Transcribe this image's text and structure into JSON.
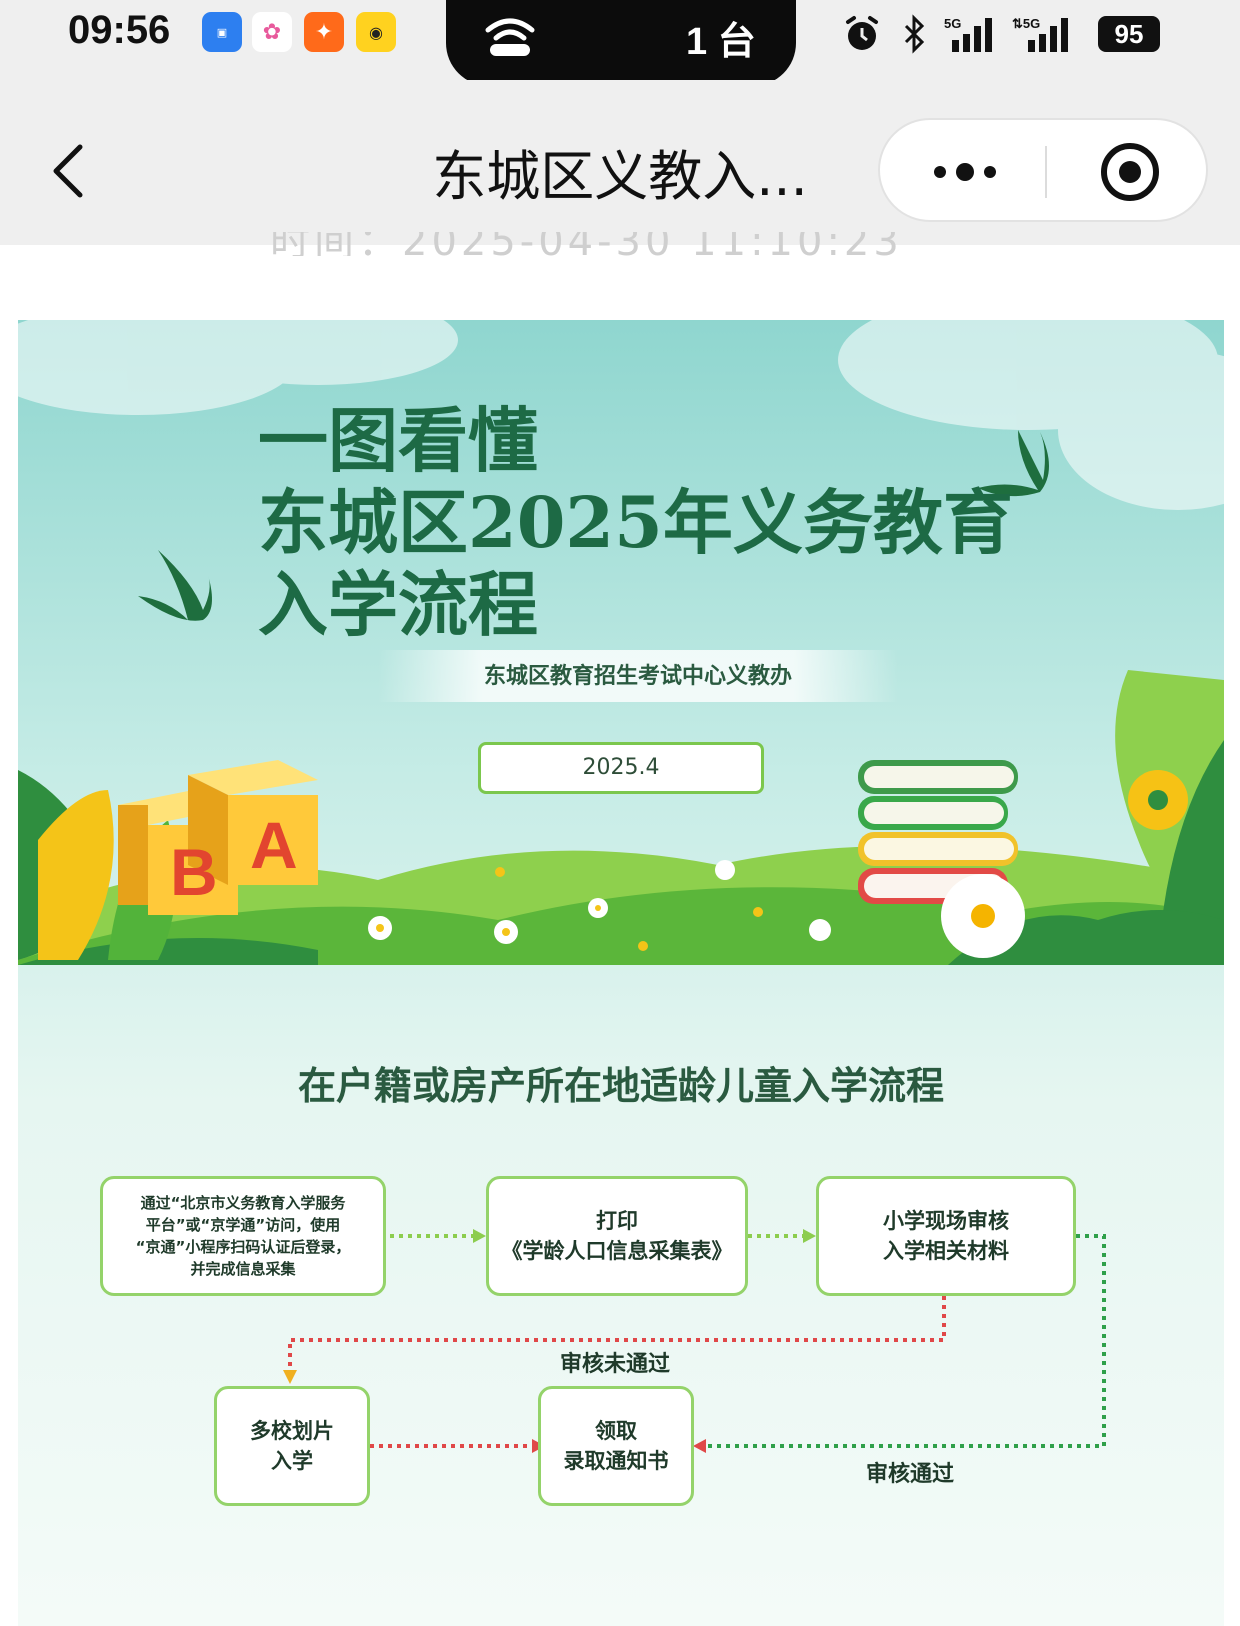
{
  "status_bar": {
    "time": "09:56",
    "pill_text": "1 台",
    "battery": "95",
    "apps": [
      "android-app",
      "chat-app",
      "runner-app",
      "yellow-app"
    ]
  },
  "nav": {
    "title": "东城区义教入..."
  },
  "scrolled_text": "时间：2025-04-30 11:10:23",
  "poster": {
    "title_lines": [
      "一图看懂",
      "东城区2025年义务教育",
      "入学流程"
    ],
    "organization": "东城区教育招生考试中心义教办",
    "date": "2025.4",
    "block_letters": [
      "B",
      "A"
    ],
    "section_title": "在户籍或房产所在地适龄儿童入学流程",
    "flow": {
      "step1": "通过“北京市义务教育入学服务\n平台”或“京学通”访问，使用\n“京通”小程序扫码认证后登录，\n并完成信息采集",
      "step2": "打印\n《学龄人口信息采集表》",
      "step3": "小学现场审核\n入学相关材料",
      "step4": "多校划片\n入学",
      "step5": "领取\n录取通知书",
      "label_fail": "审核未通过",
      "label_pass": "审核通过"
    }
  },
  "colors": {
    "title_green": "#1d6a45",
    "box_border": "#94d36a",
    "arrow_green": "#8ccd4e",
    "arrow_red": "#e04848"
  }
}
